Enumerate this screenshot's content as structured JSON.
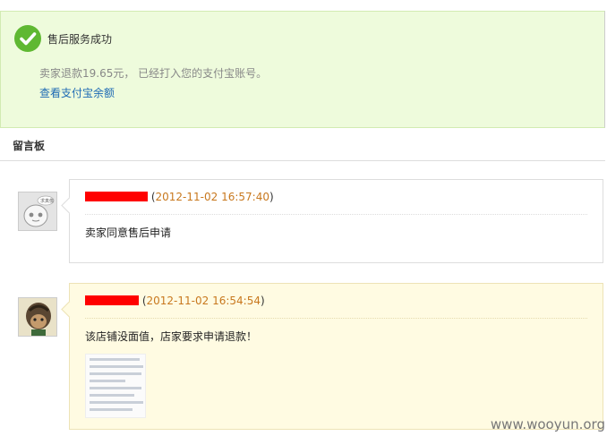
{
  "success": {
    "title": "售后服务成功",
    "description": "卖家退款19.65元， 已经打入您的支付宝账号。",
    "balance_link": "查看支付宝余额"
  },
  "board": {
    "label": "留言板",
    "messages": [
      {
        "time": "2012-11-02 16:57:40",
        "text": "卖家同意售后申请"
      },
      {
        "time": "2012-11-02 16:54:54",
        "text": "该店铺没面值，店家要求申请退款！"
      }
    ]
  },
  "watermark": "www.wooyun.org",
  "colors": {
    "banner_bg": "#eefbdc",
    "check_green": "#5fb832",
    "link_blue": "#1e6ab4",
    "time_orange": "#c8781e",
    "redaction": "#ff0000",
    "buyer_bubble_bg": "#fffbe2"
  }
}
